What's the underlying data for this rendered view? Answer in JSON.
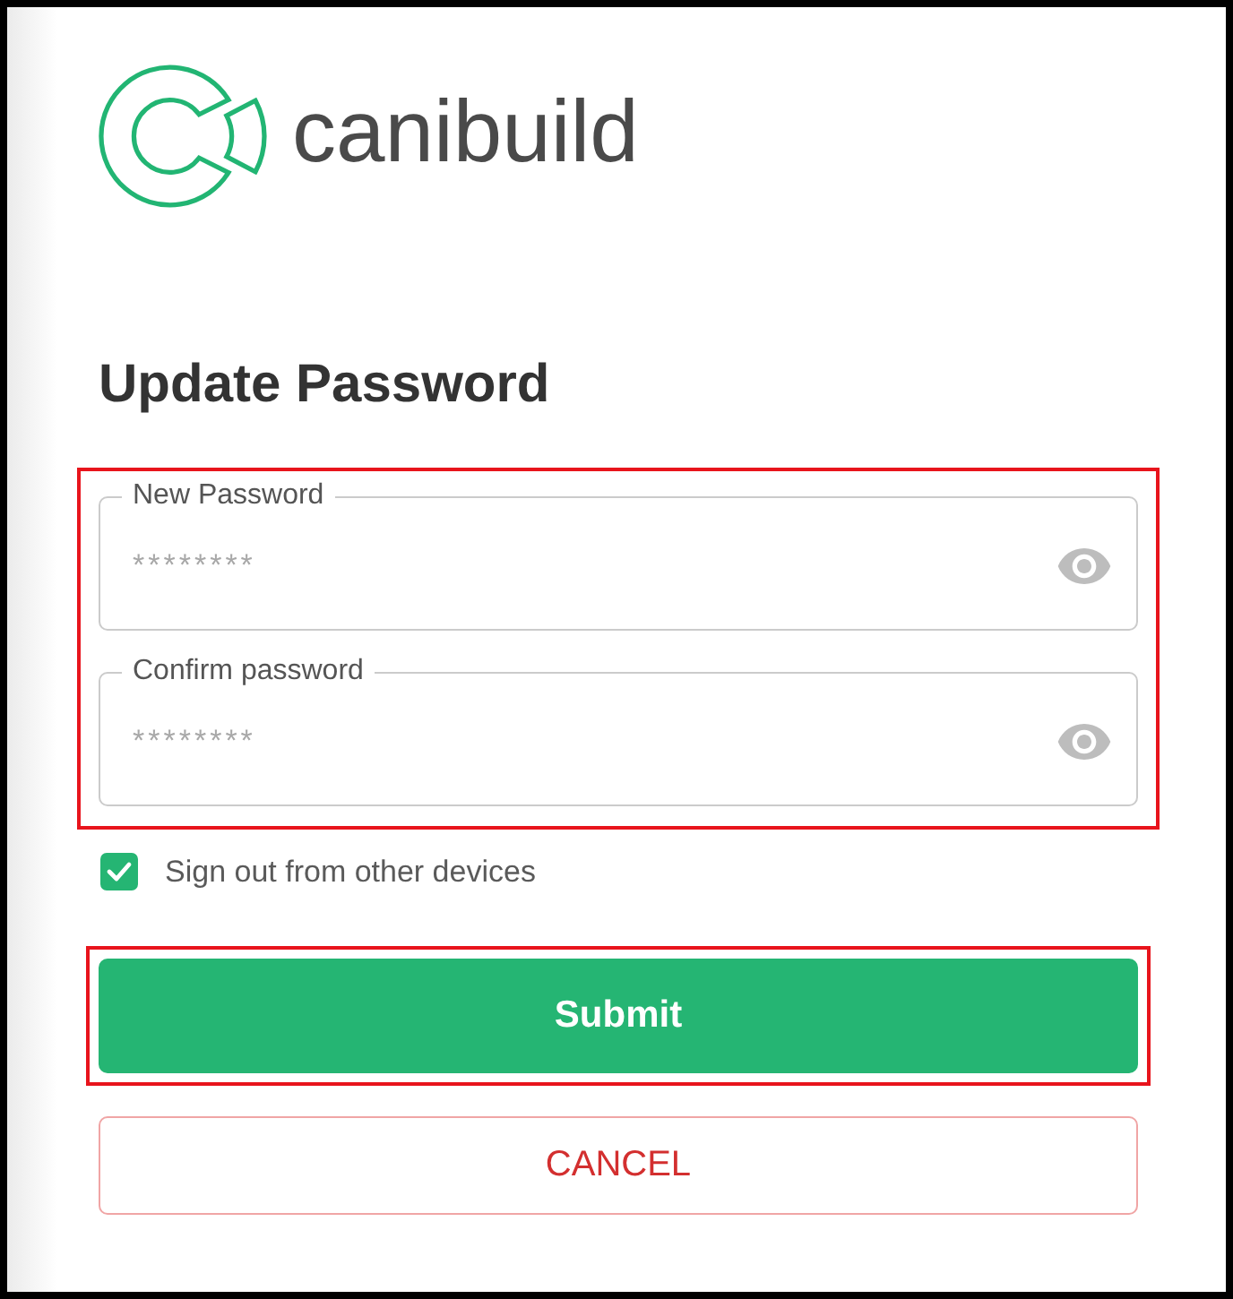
{
  "brand": {
    "name": "canibuild"
  },
  "title": "Update Password",
  "password_fields": {
    "highlighted": true,
    "fields": [
      {
        "label": "New Password",
        "placeholder": "********"
      },
      {
        "label": "Confirm password",
        "placeholder": "********"
      }
    ]
  },
  "sign_out_option": {
    "label": "Sign out from other devices",
    "checked": true
  },
  "buttons": [
    {
      "kind": "primary",
      "label": "Submit",
      "highlighted": true
    },
    {
      "kind": "outline",
      "label": "CANCEL",
      "highlighted": false
    }
  ]
}
